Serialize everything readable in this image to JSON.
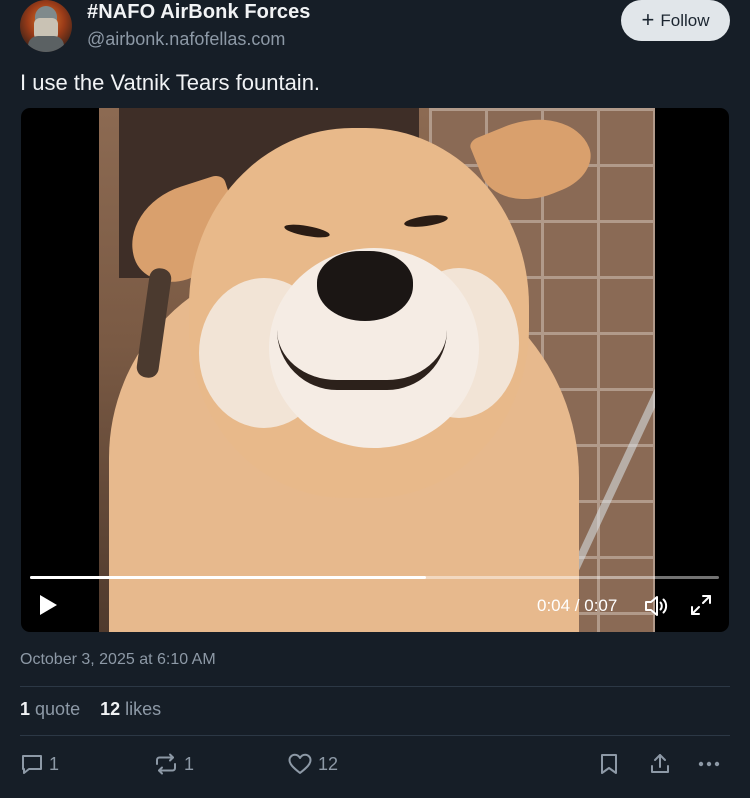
{
  "author": {
    "display_name": "#NAFO AirBonk Forces",
    "handle": "@airbonk.nafofellas.com"
  },
  "follow": {
    "label": "Follow",
    "icon": "plus-icon"
  },
  "post": {
    "text": "I use the Vatnik Tears fountain."
  },
  "video": {
    "time_label": "0:04 / 0:07",
    "progress": 0.575
  },
  "timestamp": "October 3, 2025 at 6:10 AM",
  "stats": {
    "quotes_count": "1",
    "quotes_label": "quote",
    "likes_count": "12",
    "likes_label": "likes"
  },
  "actions": {
    "reply_count": "1",
    "repost_count": "1",
    "like_count": "12"
  },
  "colors": {
    "background": "#161e27",
    "muted_text": "#8d99a6",
    "follow_button_bg": "#e1e6ea"
  }
}
